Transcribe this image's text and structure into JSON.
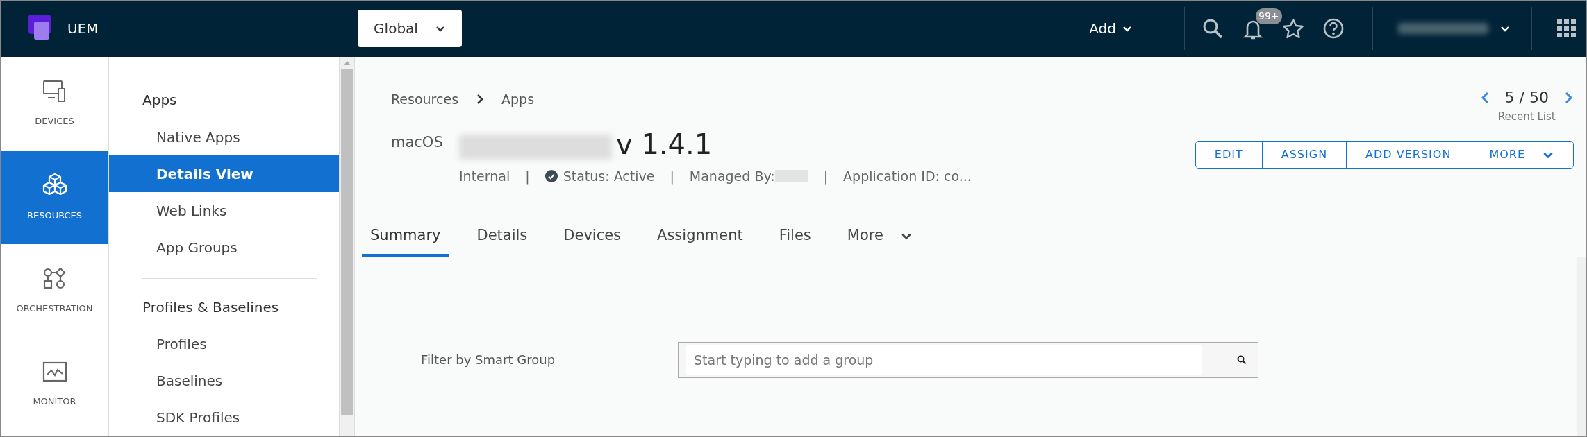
{
  "top_bar": {
    "logo_text": "UEM",
    "org_selector": "Global",
    "add_menu": "Add",
    "notification_badge": "99+",
    "user_redacted": true
  },
  "nav_rail": [
    {
      "label": "DEVICES",
      "selected": false
    },
    {
      "label": "RESOURCES",
      "selected": true
    },
    {
      "label": "ORCHESTRATION",
      "selected": false
    },
    {
      "label": "MONITOR",
      "selected": false
    }
  ],
  "sub_nav": [
    {
      "kind": "header",
      "label": "Apps"
    },
    {
      "kind": "link",
      "label": "Native Apps",
      "selected": false
    },
    {
      "kind": "link",
      "label": "Details View",
      "selected": true
    },
    {
      "kind": "link",
      "label": "Web Links",
      "selected": false
    },
    {
      "kind": "link",
      "label": "App Groups",
      "selected": false
    },
    {
      "kind": "divider"
    },
    {
      "kind": "header",
      "label": "Profiles & Baselines"
    },
    {
      "kind": "link",
      "label": "Profiles",
      "selected": false
    },
    {
      "kind": "link",
      "label": "Baselines",
      "selected": false
    },
    {
      "kind": "link",
      "label": "SDK Profiles",
      "selected": false
    }
  ],
  "breadcrumb": [
    "Resources",
    "Apps"
  ],
  "pager": {
    "position": "5 / 50",
    "caption": "Recent List"
  },
  "app": {
    "platform": "macOS",
    "name_redacted": true,
    "version": "v 1.4.1",
    "separator": "|",
    "meta": [
      {
        "kind": "text",
        "text": "Internal"
      },
      {
        "kind": "status",
        "text": "Status: Active"
      },
      {
        "kind": "redacted",
        "text": "Managed By:"
      },
      {
        "kind": "text",
        "text": "Application ID: co..."
      }
    ]
  },
  "actions": [
    {
      "label": "EDIT",
      "dropdown": false
    },
    {
      "label": "ASSIGN",
      "dropdown": false
    },
    {
      "label": "ADD VERSION",
      "dropdown": false
    },
    {
      "label": "MORE",
      "dropdown": true
    }
  ],
  "tabs": [
    {
      "label": "Summary",
      "selected": true,
      "dropdown": false
    },
    {
      "label": "Details",
      "selected": false,
      "dropdown": false
    },
    {
      "label": "Devices",
      "selected": false,
      "dropdown": false
    },
    {
      "label": "Assignment",
      "selected": false,
      "dropdown": false
    },
    {
      "label": "Files",
      "selected": false,
      "dropdown": false
    },
    {
      "label": "More",
      "selected": false,
      "dropdown": true
    }
  ],
  "filter": {
    "label": "Filter by Smart Group",
    "placeholder": "Start typing to add a group"
  }
}
